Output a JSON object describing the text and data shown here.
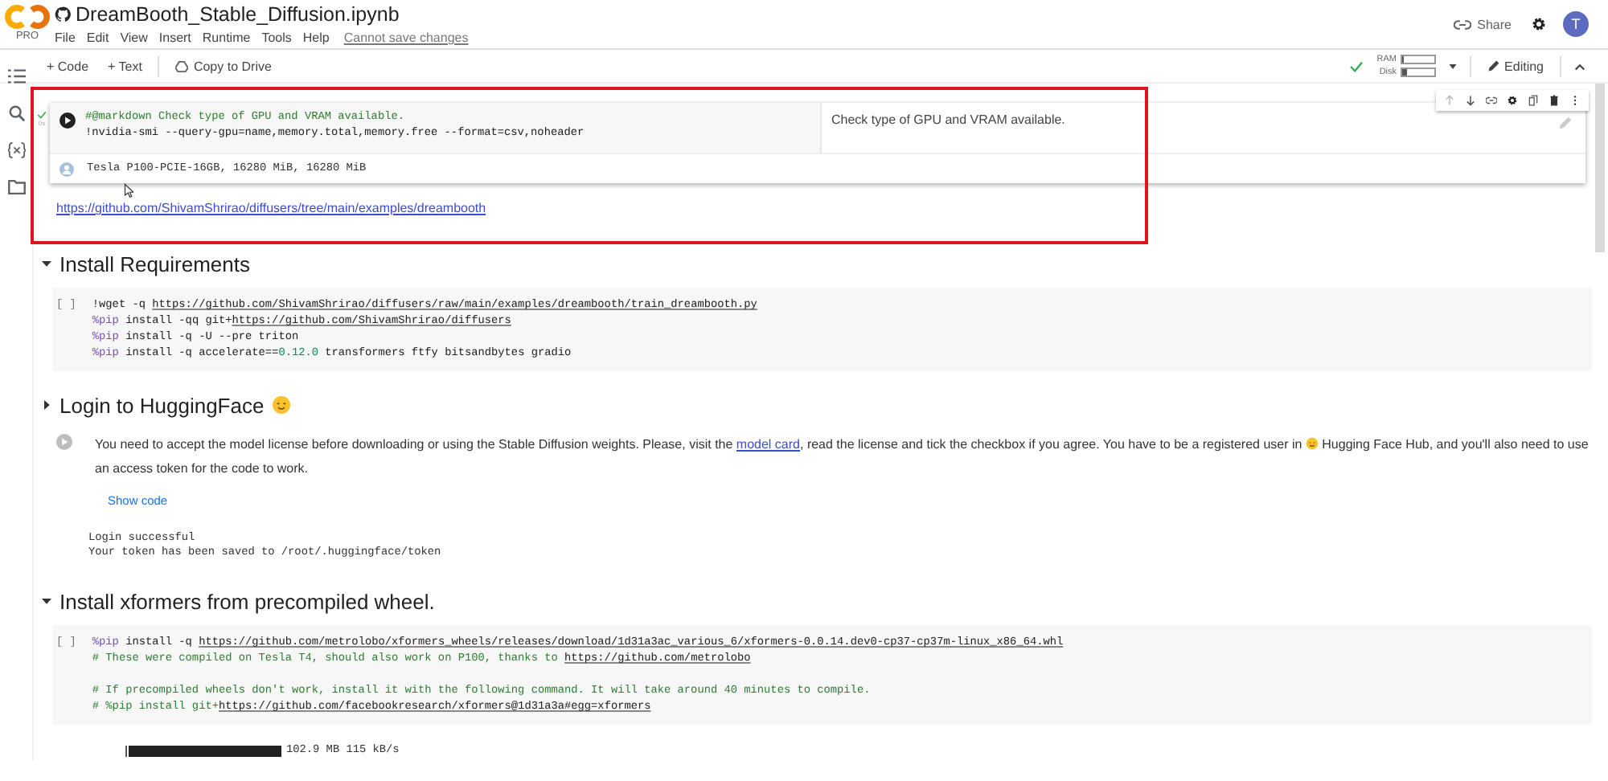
{
  "header": {
    "badge": "PRO",
    "title": "DreamBooth_Stable_Diffusion.ipynb",
    "menu": [
      "File",
      "Edit",
      "View",
      "Insert",
      "Runtime",
      "Tools",
      "Help"
    ],
    "save_notice": "Cannot save changes",
    "share": "Share",
    "avatar": "T"
  },
  "toolbar": {
    "buttons": [
      "+ Code",
      "+ Text",
      "Copy to Drive"
    ],
    "connected": true,
    "meters": [
      {
        "label": "RAM",
        "level": 0.05
      },
      {
        "label": "Disk",
        "level": 0.18
      }
    ],
    "mode": "Editing"
  },
  "cells": [
    {
      "kind": "form",
      "selected": true,
      "executed": true,
      "exec_time": "0s",
      "code": [
        {
          "lines": [
            {
              "tokens": [
                {
                  "kind": "comment",
                  "text": "#@markdown Check type of GPU and VRAM available."
                }
              ]
            },
            {
              "tokens": [
                {
                  "kind": "plain",
                  "text": "!nvidia-smi --query-gpu=name,memory.total,memory.free --format=csv,noheader"
                }
              ]
            }
          ]
        }
      ],
      "description": "Check type of GPU and VRAM available.",
      "output": [
        "Tesla P100-PCIE-16GB, 16280 MiB, 16280 MiB"
      ]
    },
    {
      "kind": "link",
      "text": "https://github.com/ShivamShrirao/diffusers/tree/main/examples/dreambooth"
    },
    {
      "kind": "section",
      "title": "Install Requirements",
      "expanded": true
    },
    {
      "kind": "code",
      "prompt": "[ ]",
      "code": [
        {
          "lines": [
            {
              "tokens": [
                {
                  "kind": "plain",
                  "text": "!wget -q "
                },
                {
                  "kind": "link",
                  "text": "https://github.com/ShivamShrirao/diffusers/raw/main/examples/dreambooth/train_dreambooth.py"
                }
              ]
            },
            {
              "tokens": [
                {
                  "kind": "magic",
                  "text": "%pip"
                },
                {
                  "kind": "plain",
                  "text": " install -qq git+"
                },
                {
                  "kind": "link",
                  "text": "https://github.com/ShivamShrirao/diffusers"
                }
              ]
            },
            {
              "tokens": [
                {
                  "kind": "magic",
                  "text": "%pip"
                },
                {
                  "kind": "plain",
                  "text": " install -q -U --pre triton"
                }
              ]
            },
            {
              "tokens": [
                {
                  "kind": "magic",
                  "text": "%pip"
                },
                {
                  "kind": "plain",
                  "text": " install -q accelerate=="
                },
                {
                  "kind": "number",
                  "text": "0.12.0"
                },
                {
                  "kind": "plain",
                  "text": " transformers ftfy bitsandbytes gradio"
                }
              ]
            }
          ]
        }
      ]
    },
    {
      "kind": "section",
      "title": "Login to HuggingFace",
      "emoji": true,
      "expanded": false
    },
    {
      "kind": "text",
      "parts": [
        {
          "kind": "plain",
          "text": "You need to accept the model license before downloading or using the Stable Diffusion weights. Please, visit the "
        },
        {
          "kind": "link",
          "text": "model card"
        },
        {
          "kind": "plain",
          "text": ", read the license and tick the checkbox if you agree. You have to be a registered user in "
        },
        {
          "kind": "emoji"
        },
        {
          "kind": "plain",
          "text": " Hugging Face Hub, and you'll also need to use an access token for the code to work."
        }
      ],
      "show_code": "Show code",
      "output": [
        "Login successful",
        "Your token has been saved to /root/.huggingface/token"
      ]
    },
    {
      "kind": "section",
      "title": "Install xformers from precompiled wheel.",
      "expanded": true
    },
    {
      "kind": "code",
      "prompt": "[ ]",
      "code": [
        {
          "lines": [
            {
              "tokens": [
                {
                  "kind": "magic",
                  "text": "%pip"
                },
                {
                  "kind": "plain",
                  "text": " install -q "
                },
                {
                  "kind": "link",
                  "text": "https://github.com/metrolobo/xformers_wheels/releases/download/1d31a3ac_various_6/xformers-0.0.14.dev0-cp37-cp37m-linux_x86_64.whl"
                }
              ]
            },
            {
              "tokens": [
                {
                  "kind": "comment",
                  "text": "# These were compiled on Tesla T4, should also work on P100, thanks to "
                },
                {
                  "kind": "link",
                  "text": "https://github.com/metrolobo"
                }
              ]
            }
          ]
        },
        {
          "lines": [
            {
              "tokens": [
                {
                  "kind": "comment",
                  "text": "# If precompiled wheels don't work, install it with the following command. It will take around 40 minutes to compile."
                }
              ]
            },
            {
              "tokens": [
                {
                  "kind": "comment",
                  "text": "# %pip install git+"
                },
                {
                  "kind": "link",
                  "text": "https://github.com/facebookresearch/xformers@1d31a3a#egg=xformers"
                }
              ]
            }
          ]
        }
      ],
      "progress": {
        "level": 1,
        "reading": "102.9 MB 115 kB/s"
      }
    }
  ]
}
